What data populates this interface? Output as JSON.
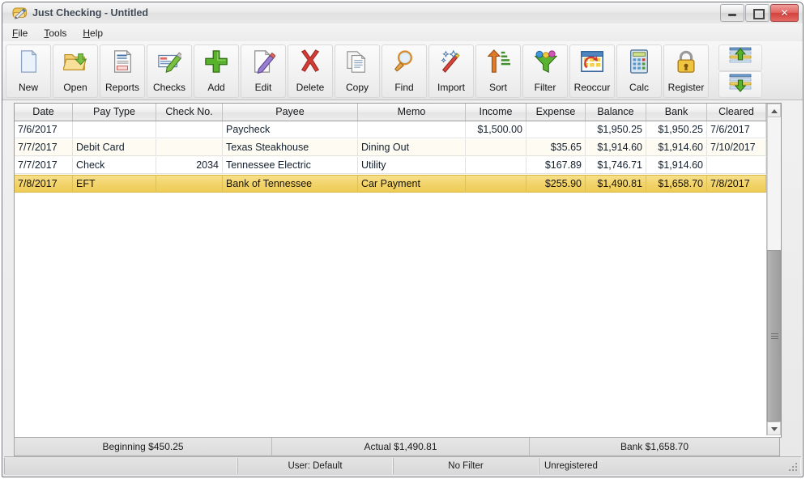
{
  "window": {
    "title": "Just Checking - Untitled",
    "app_icon": "checkbook-icon",
    "minimize_label": "",
    "maximize_label": "",
    "close_label": "✕"
  },
  "menu": [
    {
      "label_pre": "",
      "mnemonic": "F",
      "label_post": "ile",
      "name": "menu-file"
    },
    {
      "label_pre": "",
      "mnemonic": "T",
      "label_post": "ools",
      "name": "menu-tools"
    },
    {
      "label_pre": "",
      "mnemonic": "H",
      "label_post": "elp",
      "name": "menu-help"
    }
  ],
  "toolbar": {
    "buttons": [
      {
        "label": "New",
        "icon": "new-document-icon"
      },
      {
        "label": "Open",
        "icon": "open-folder-icon"
      },
      {
        "label": "Reports",
        "icon": "report-document-icon"
      },
      {
        "label": "Checks",
        "icon": "check-pen-icon"
      },
      {
        "label": "Add",
        "icon": "plus-icon"
      },
      {
        "label": "Edit",
        "icon": "edit-pencil-icon"
      },
      {
        "label": "Delete",
        "icon": "delete-x-icon"
      },
      {
        "label": "Copy",
        "icon": "copy-pages-icon"
      },
      {
        "label": "Find",
        "icon": "magnifier-icon"
      },
      {
        "label": "Import",
        "icon": "magic-wand-icon"
      },
      {
        "label": "Sort",
        "icon": "sort-ascending-icon"
      },
      {
        "label": "Filter",
        "icon": "funnel-icon"
      },
      {
        "label": "Reoccur",
        "icon": "calendar-recurring-icon"
      },
      {
        "label": "Calc",
        "icon": "calculator-icon"
      },
      {
        "label": "Register",
        "icon": "padlock-icon"
      }
    ],
    "mini_buttons": [
      {
        "icon": "scroll-top-icon"
      },
      {
        "icon": "scroll-bottom-icon"
      }
    ]
  },
  "grid": {
    "columns": [
      {
        "label": "Date",
        "align": "a-l"
      },
      {
        "label": "Pay Type",
        "align": "a-l"
      },
      {
        "label": "Check No.",
        "align": "a-r"
      },
      {
        "label": "Payee",
        "align": "a-l"
      },
      {
        "label": "Memo",
        "align": "a-l"
      },
      {
        "label": "Income",
        "align": "a-r"
      },
      {
        "label": "Expense",
        "align": "a-r"
      },
      {
        "label": "Balance",
        "align": "a-r"
      },
      {
        "label": "Bank",
        "align": "a-r"
      },
      {
        "label": "Cleared",
        "align": "a-l"
      }
    ],
    "rows": [
      {
        "selected": false,
        "alt": false,
        "cells": [
          "7/6/2017",
          "",
          "",
          "Paycheck",
          "",
          "$1,500.00",
          "",
          "$1,950.25",
          "$1,950.25",
          "7/6/2017"
        ]
      },
      {
        "selected": false,
        "alt": true,
        "cells": [
          "7/7/2017",
          "Debit Card",
          "",
          "Texas Steakhouse",
          "Dining Out",
          "",
          "$35.65",
          "$1,914.60",
          "$1,914.60",
          "7/10/2017"
        ]
      },
      {
        "selected": false,
        "alt": false,
        "cells": [
          "7/7/2017",
          "Check",
          "2034",
          "Tennessee Electric",
          "Utility",
          "",
          "$167.89",
          "$1,746.71",
          "$1,914.60",
          ""
        ]
      },
      {
        "selected": true,
        "alt": false,
        "cells": [
          "7/8/2017",
          "EFT",
          "",
          "Bank of Tennessee",
          "Car Payment",
          "",
          "$255.90",
          "$1,490.81",
          "$1,658.70",
          "7/8/2017"
        ]
      }
    ],
    "scrollbar": {
      "up_arrow": "scroll-up-arrow",
      "down_arrow": "scroll-down-arrow"
    }
  },
  "status_bar": {
    "panels": [
      {
        "text": "Beginning $450.25",
        "name": "status-beginning"
      },
      {
        "text": "Actual $1,490.81",
        "name": "status-actual"
      },
      {
        "text": "Bank $1,658.70",
        "name": "status-bank"
      }
    ]
  },
  "status_bar_2": {
    "panels": [
      {
        "text": "",
        "name": "status2-empty"
      },
      {
        "text": "User: Default",
        "name": "status2-user"
      },
      {
        "text": "No Filter",
        "name": "status2-filter"
      },
      {
        "text": "Unregistered",
        "name": "status2-registration"
      }
    ]
  },
  "colors": {
    "selection": "#f2d46b",
    "alt_row": "#fdfbf2",
    "close_button": "#d2413c",
    "text": "#14202e"
  }
}
